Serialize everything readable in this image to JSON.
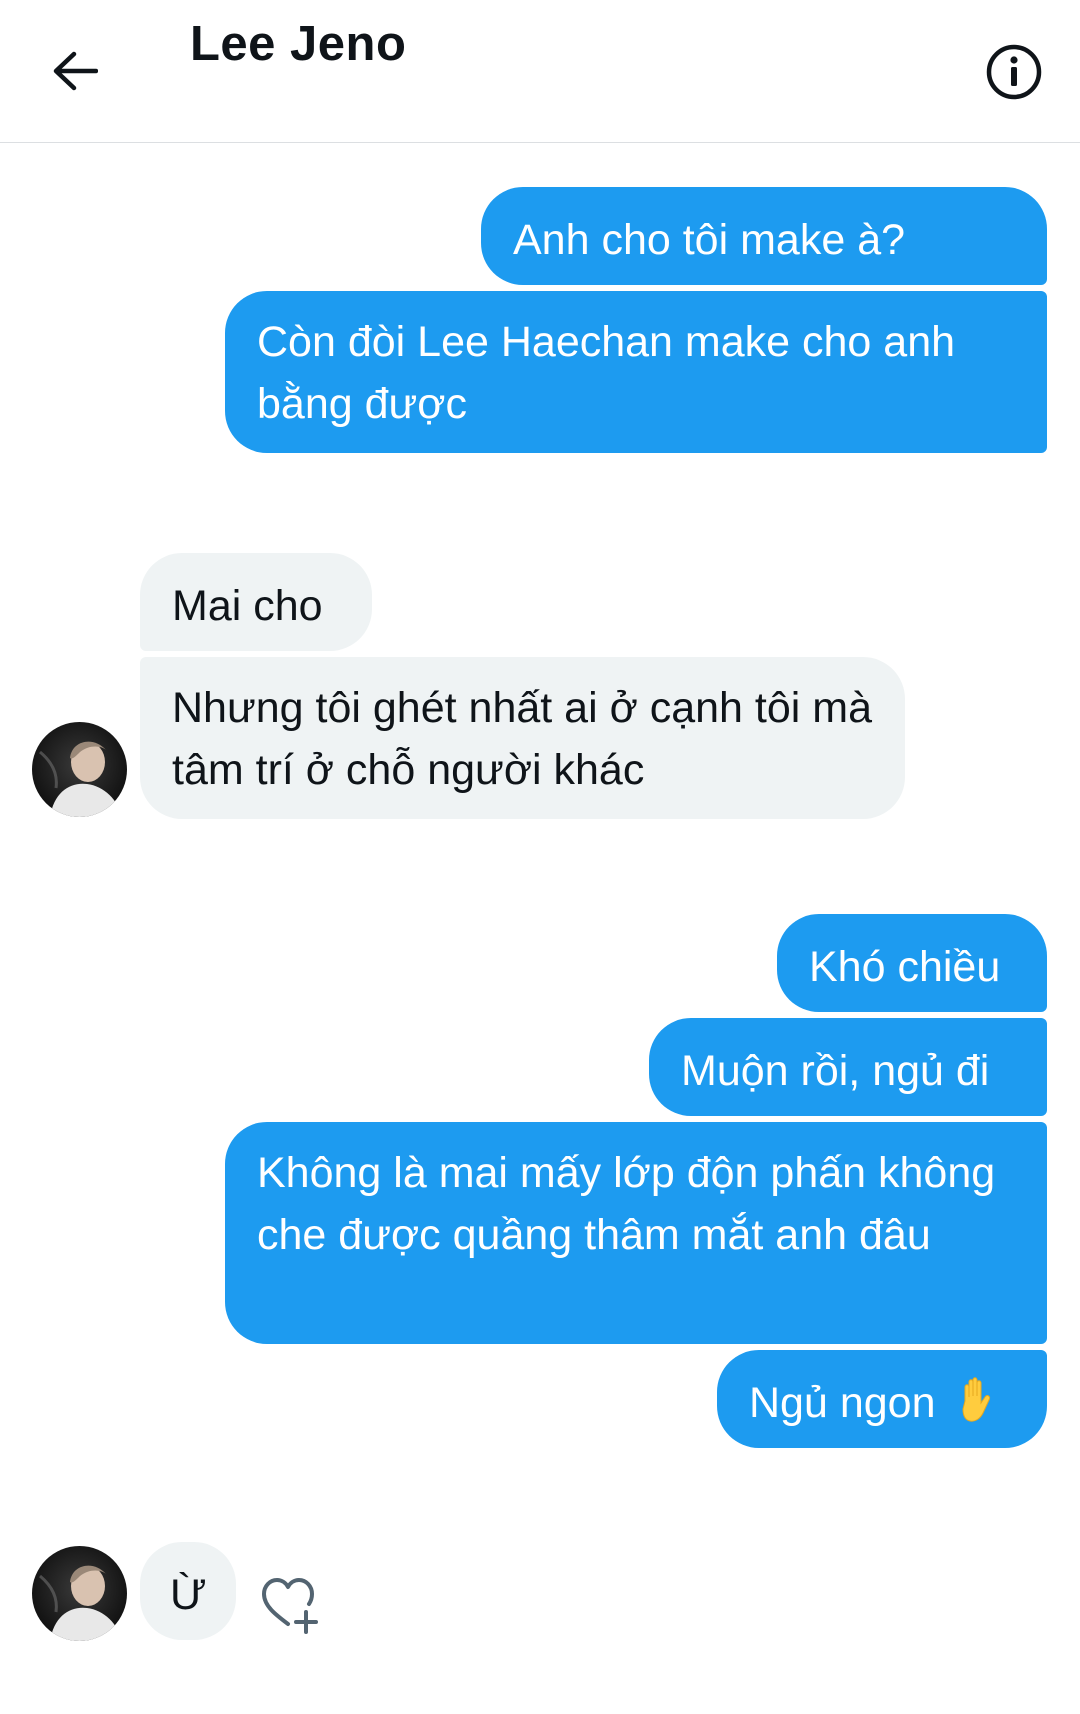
{
  "header": {
    "title": "Lee Jeno",
    "back_icon": "arrow-left-icon",
    "info_icon": "info-circle-icon"
  },
  "messages": [
    {
      "side": "out",
      "text": "Anh cho tôi make à?"
    },
    {
      "side": "out",
      "text": "Còn đòi Lee Haechan make cho anh bằng được"
    },
    {
      "side": "in",
      "text": "Mai cho"
    },
    {
      "side": "in",
      "text": "Nhưng tôi ghét nhất ai ở cạnh tôi mà tâm trí ở chỗ người khác"
    },
    {
      "side": "out",
      "text": "Khó chiều"
    },
    {
      "side": "out",
      "text": "Muộn rồi, ngủ đi"
    },
    {
      "side": "out",
      "text": "Không là mai mấy lớp độn phấn không che được quầng thâm mắt anh đâu"
    },
    {
      "side": "out",
      "text": "Ngủ ngon",
      "emoji_icon": "raised-hand-icon"
    },
    {
      "side": "in",
      "text": "Ừ"
    }
  ],
  "reaction": {
    "icon": "heart-add-icon"
  },
  "colors": {
    "outgoing_bubble": "#1d9bf0",
    "incoming_bubble": "#eff3f4",
    "text": "#0f1419"
  }
}
